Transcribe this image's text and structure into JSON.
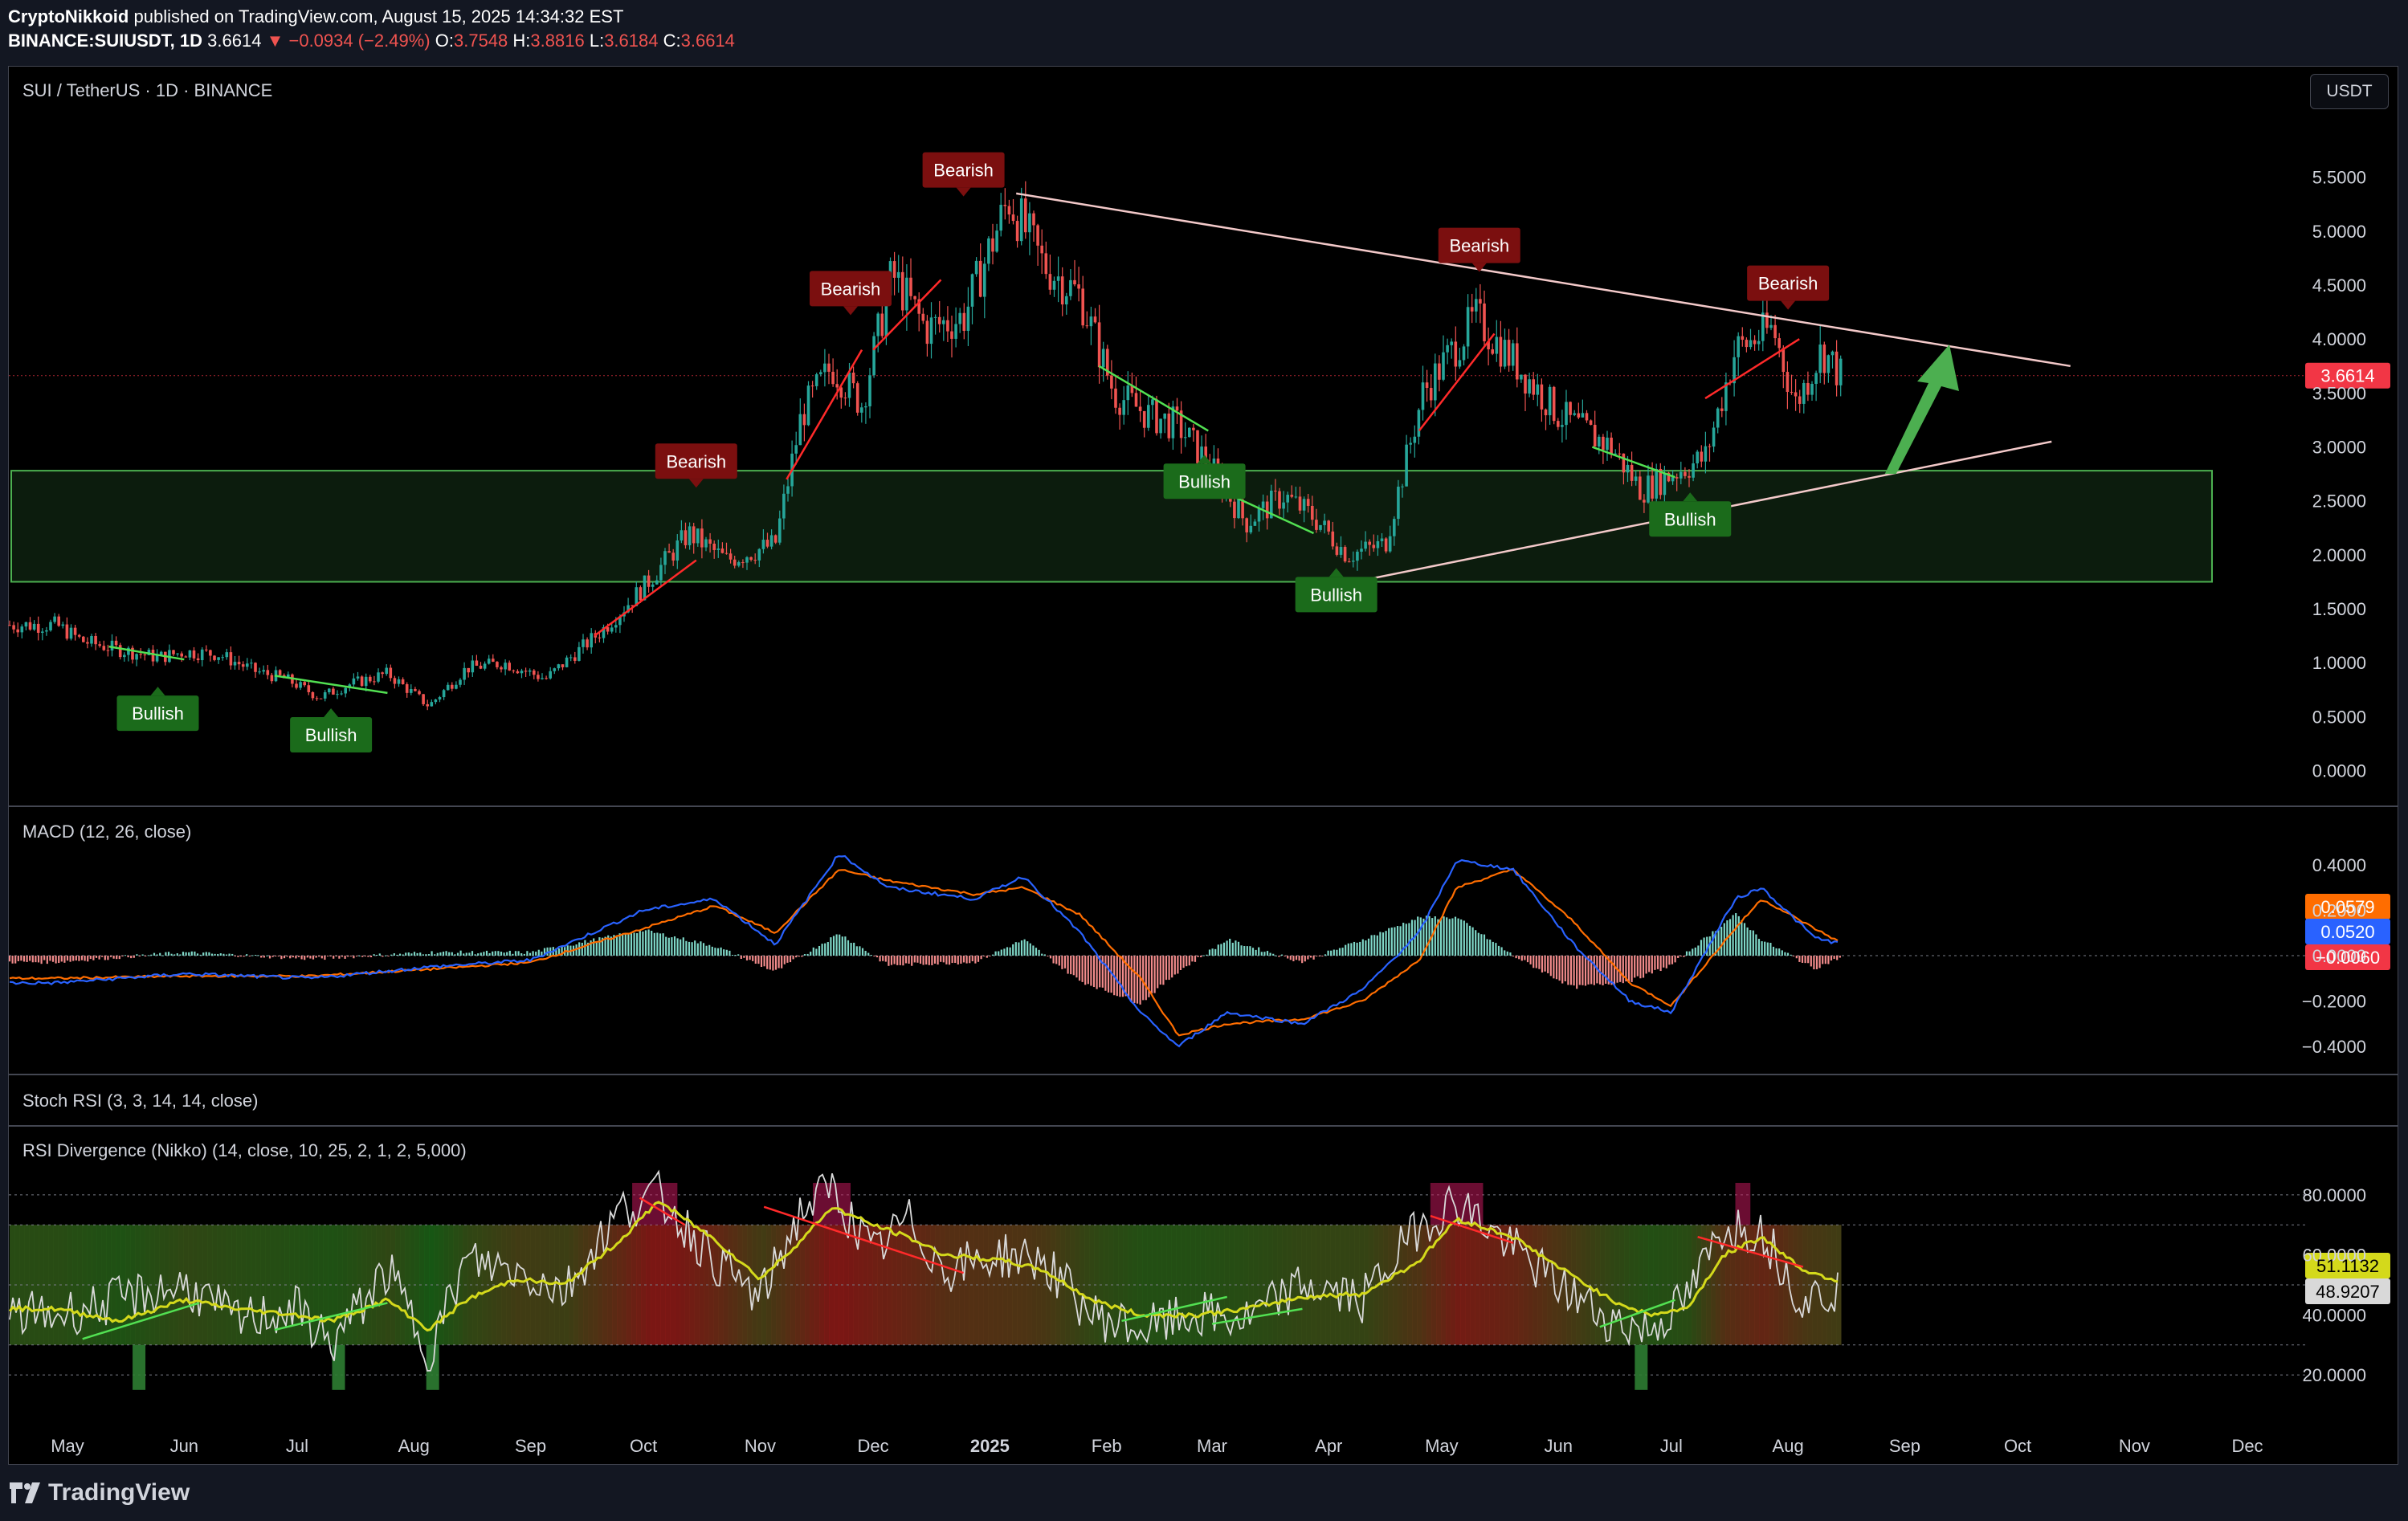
{
  "header": {
    "publisher": "CryptoNikkoid",
    "published_text": "published on TradingView.com, August 15, 2025 14:34:32 EST",
    "symbol": "BINANCE:SUIUSDT, 1D",
    "last": "3.6614",
    "change": "−0.0934 (−2.49%)",
    "ohlc_o_label": "O:",
    "ohlc_o": "3.7548",
    "ohlc_h_label": "H:",
    "ohlc_h": "3.8816",
    "ohlc_l_label": "L:",
    "ohlc_l": "3.6184",
    "ohlc_c_label": "C:",
    "ohlc_c": "3.6614"
  },
  "pane_labels": {
    "main": "SUI / TetherUS · 1D · BINANCE",
    "macd": "MACD (12, 26, close)",
    "stoch": "Stoch RSI (3, 3, 14, 14, close)",
    "rsi": "RSI Divergence (Nikko) (14, close, 10, 25, 2, 1, 2, 5,000)"
  },
  "currency_button": "USDT",
  "brand": "TradingView",
  "colors": {
    "background": "#000000",
    "up": "#26a69a",
    "down": "#ef5350",
    "zone": "#4caf50",
    "bearish_label": "#7b0f0f",
    "bullish_label": "#1b6b1b",
    "trendline": "#f3c9c9",
    "macd_line": "#2962ff",
    "signal_line": "#ff6d00",
    "rsi_line": "#d9d9d9",
    "rsi_ma": "#d4d91b",
    "arrow": "#4caf50",
    "price_tag": "#f23645"
  },
  "chart_data": [
    {
      "type": "candlestick",
      "title": "SUI / TetherUS · 1D · BINANCE",
      "x_ticks": [
        "May",
        "Jun",
        "Jul",
        "Aug",
        "Sep",
        "Oct",
        "Nov",
        "Dec",
        "2025",
        "Feb",
        "Mar",
        "Apr",
        "May",
        "Jun",
        "Jul",
        "Aug",
        "Sep",
        "Oct",
        "Nov",
        "Dec"
      ],
      "y_ticks": [
        "5.5000",
        "5.0000",
        "4.5000",
        "4.0000",
        "3.5000",
        "3.0000",
        "2.5000",
        "2.0000",
        "1.5000",
        "1.0000",
        "0.5000",
        "0.0000"
      ],
      "ylim": [
        -0.1,
        5.9
      ],
      "last_price_label": "3.6614",
      "price_path": [
        [
          "2024-04-28",
          1.35
        ],
        [
          "2024-05-05",
          1.2
        ],
        [
          "2024-05-15",
          1.12
        ],
        [
          "2024-05-25",
          1.05
        ],
        [
          "2024-06-01",
          1.1
        ],
        [
          "2024-06-10",
          1.08
        ],
        [
          "2024-06-20",
          0.92
        ],
        [
          "2024-06-28",
          0.85
        ],
        [
          "2024-07-07",
          0.68
        ],
        [
          "2024-07-15",
          0.8
        ],
        [
          "2024-07-25",
          0.9
        ],
        [
          "2024-08-05",
          0.6
        ],
        [
          "2024-08-15",
          0.95
        ],
        [
          "2024-08-25",
          1.0
        ],
        [
          "2024-09-05",
          0.85
        ],
        [
          "2024-09-20",
          1.3
        ],
        [
          "2024-10-01",
          1.7
        ],
        [
          "2024-10-13",
          2.2
        ],
        [
          "2024-10-23",
          1.95
        ],
        [
          "2024-11-05",
          2.1
        ],
        [
          "2024-11-12",
          3.3
        ],
        [
          "2024-11-20",
          3.75
        ],
        [
          "2024-11-28",
          3.4
        ],
        [
          "2024-12-06",
          4.6
        ],
        [
          "2024-12-15",
          4.1
        ],
        [
          "2024-12-25",
          4.2
        ],
        [
          "2025-01-06",
          5.3
        ],
        [
          "2025-01-15",
          4.7
        ],
        [
          "2025-01-25",
          4.4
        ],
        [
          "2025-02-03",
          3.5
        ],
        [
          "2025-02-12",
          3.3
        ],
        [
          "2025-02-20",
          3.2
        ],
        [
          "2025-03-01",
          2.8
        ],
        [
          "2025-03-10",
          2.3
        ],
        [
          "2025-03-20",
          2.55
        ],
        [
          "2025-03-28",
          2.35
        ],
        [
          "2025-04-06",
          2.0
        ],
        [
          "2025-04-16",
          2.1
        ],
        [
          "2025-04-26",
          3.5
        ],
        [
          "2025-05-10",
          4.2
        ],
        [
          "2025-05-20",
          3.8
        ],
        [
          "2025-06-01",
          3.3
        ],
        [
          "2025-06-15",
          3.0
        ],
        [
          "2025-06-23",
          2.6
        ],
        [
          "2025-07-01",
          2.75
        ],
        [
          "2025-07-10",
          2.9
        ],
        [
          "2025-07-18",
          3.9
        ],
        [
          "2025-07-28",
          4.1
        ],
        [
          "2025-08-03",
          3.4
        ],
        [
          "2025-08-10",
          3.9
        ],
        [
          "2025-08-15",
          3.6614
        ]
      ],
      "support_zone": [
        1.75,
        2.78
      ],
      "trendlines": [
        {
          "name": "upper",
          "from": [
            "2025-01-08",
            5.35
          ],
          "to": [
            "2025-10-15",
            3.75
          ]
        },
        {
          "name": "lower",
          "from": [
            "2025-04-08",
            1.75
          ],
          "to": [
            "2025-10-10",
            3.05
          ]
        }
      ],
      "annotations": [
        {
          "text": "Bullish",
          "x": "2024-05-25",
          "y": 0.8
        },
        {
          "text": "Bullish",
          "x": "2024-07-10",
          "y": 0.6
        },
        {
          "text": "Bearish",
          "x": "2024-10-15",
          "y": 2.6
        },
        {
          "text": "Bearish",
          "x": "2024-11-25",
          "y": 4.2
        },
        {
          "text": "Bearish",
          "x": "2024-12-25",
          "y": 5.3
        },
        {
          "text": "Bullish",
          "x": "2025-02-27",
          "y": 2.95
        },
        {
          "text": "Bullish",
          "x": "2025-04-03",
          "y": 1.9
        },
        {
          "text": "Bearish",
          "x": "2025-05-11",
          "y": 4.6
        },
        {
          "text": "Bullish",
          "x": "2025-07-06",
          "y": 2.6
        },
        {
          "text": "Bearish",
          "x": "2025-08-01",
          "y": 4.25
        }
      ]
    },
    {
      "type": "line",
      "title": "MACD (12, 26, close)",
      "y_ticks": [
        "0.4000",
        "0.2000",
        "0.0000",
        "−0.2000",
        "−0.4000"
      ],
      "ylim": [
        -0.46,
        0.46
      ],
      "series": [
        {
          "name": "MACD",
          "value_label": "0.0520",
          "points": [
            [
              "2024-04-28",
              -0.12
            ],
            [
              "2024-06-01",
              -0.08
            ],
            [
              "2024-07-05",
              -0.1
            ],
            [
              "2024-08-05",
              -0.05
            ],
            [
              "2024-09-01",
              -0.02
            ],
            [
              "2024-10-01",
              0.2
            ],
            [
              "2024-10-20",
              0.25
            ],
            [
              "2024-11-05",
              0.05
            ],
            [
              "2024-11-22",
              0.45
            ],
            [
              "2024-12-05",
              0.3
            ],
            [
              "2024-12-28",
              0.25
            ],
            [
              "2025-01-10",
              0.35
            ],
            [
              "2025-01-25",
              0.1
            ],
            [
              "2025-02-10",
              -0.25
            ],
            [
              "2025-02-20",
              -0.4
            ],
            [
              "2025-03-05",
              -0.25
            ],
            [
              "2025-03-25",
              -0.3
            ],
            [
              "2025-04-10",
              -0.15
            ],
            [
              "2025-04-25",
              0.1
            ],
            [
              "2025-05-05",
              0.42
            ],
            [
              "2025-05-20",
              0.38
            ],
            [
              "2025-06-05",
              0.05
            ],
            [
              "2025-06-20",
              -0.2
            ],
            [
              "2025-07-01",
              -0.25
            ],
            [
              "2025-07-18",
              0.25
            ],
            [
              "2025-07-25",
              0.3
            ],
            [
              "2025-08-08",
              0.08
            ],
            [
              "2025-08-15",
              0.052
            ]
          ]
        },
        {
          "name": "Signal",
          "value_label": "0.0579",
          "points": [
            [
              "2024-04-28",
              -0.1
            ],
            [
              "2024-06-01",
              -0.09
            ],
            [
              "2024-07-05",
              -0.09
            ],
            [
              "2024-08-05",
              -0.06
            ],
            [
              "2024-09-01",
              -0.03
            ],
            [
              "2024-10-01",
              0.12
            ],
            [
              "2024-10-20",
              0.22
            ],
            [
              "2024-11-05",
              0.1
            ],
            [
              "2024-11-22",
              0.38
            ],
            [
              "2024-12-05",
              0.33
            ],
            [
              "2024-12-28",
              0.27
            ],
            [
              "2025-01-10",
              0.3
            ],
            [
              "2025-01-25",
              0.18
            ],
            [
              "2025-02-10",
              -0.1
            ],
            [
              "2025-02-20",
              -0.35
            ],
            [
              "2025-03-05",
              -0.3
            ],
            [
              "2025-03-25",
              -0.28
            ],
            [
              "2025-04-10",
              -0.2
            ],
            [
              "2025-04-25",
              -0.02
            ],
            [
              "2025-05-05",
              0.3
            ],
            [
              "2025-05-20",
              0.38
            ],
            [
              "2025-06-05",
              0.15
            ],
            [
              "2025-06-20",
              -0.12
            ],
            [
              "2025-07-01",
              -0.22
            ],
            [
              "2025-07-18",
              0.12
            ],
            [
              "2025-07-25",
              0.25
            ],
            [
              "2025-08-08",
              0.12
            ],
            [
              "2025-08-15",
              0.0579
            ]
          ]
        }
      ],
      "histogram_label": "−0.0060"
    },
    {
      "type": "line",
      "title": "RSI Divergence (Nikko) (14, close, 10, 25, 2, 1, 2, 5,000)",
      "y_ticks": [
        "80.0000",
        "60.0000",
        "40.0000",
        "20.0000"
      ],
      "ylim": [
        12,
        88
      ],
      "bands": [
        30,
        70
      ],
      "series": [
        {
          "name": "RSI",
          "value_label": "48.9207",
          "points": [
            [
              "2024-04-28",
              40
            ],
            [
              "2024-05-15",
              45
            ],
            [
              "2024-06-01",
              50
            ],
            [
              "2024-06-15",
              38
            ],
            [
              "2024-07-01",
              42
            ],
            [
              "2024-07-10",
              30
            ],
            [
              "2024-07-25",
              55
            ],
            [
              "2024-08-05",
              28
            ],
            [
              "2024-08-15",
              58
            ],
            [
              "2024-08-28",
              55
            ],
            [
              "2024-09-10",
              48
            ],
            [
              "2024-09-25",
              75
            ],
            [
              "2024-10-05",
              80
            ],
            [
              "2024-10-20",
              58
            ],
            [
              "2024-11-01",
              45
            ],
            [
              "2024-11-12",
              75
            ],
            [
              "2024-11-20",
              82
            ],
            [
              "2024-12-01",
              60
            ],
            [
              "2024-12-10",
              72
            ],
            [
              "2024-12-20",
              55
            ],
            [
              "2025-01-05",
              60
            ],
            [
              "2025-01-15",
              58
            ],
            [
              "2025-01-28",
              40
            ],
            [
              "2025-02-10",
              35
            ],
            [
              "2025-02-25",
              40
            ],
            [
              "2025-03-10",
              38
            ],
            [
              "2025-03-25",
              50
            ],
            [
              "2025-04-10",
              45
            ],
            [
              "2025-04-25",
              70
            ],
            [
              "2025-05-05",
              78
            ],
            [
              "2025-05-20",
              62
            ],
            [
              "2025-06-01",
              50
            ],
            [
              "2025-06-15",
              38
            ],
            [
              "2025-06-25",
              35
            ],
            [
              "2025-07-05",
              45
            ],
            [
              "2025-07-15",
              70
            ],
            [
              "2025-07-25",
              68
            ],
            [
              "2025-08-05",
              45
            ],
            [
              "2025-08-15",
              48.9207
            ]
          ]
        },
        {
          "name": "RSI MA",
          "value_label": "51.1132",
          "points": [
            [
              "2024-04-28",
              42
            ],
            [
              "2024-05-15",
              38
            ],
            [
              "2024-06-01",
              45
            ],
            [
              "2024-06-15",
              42
            ],
            [
              "2024-07-01",
              40
            ],
            [
              "2024-07-10",
              38
            ],
            [
              "2024-07-25",
              45
            ],
            [
              "2024-08-05",
              35
            ],
            [
              "2024-08-15",
              45
            ],
            [
              "2024-08-28",
              52
            ],
            [
              "2024-09-10",
              50
            ],
            [
              "2024-09-25",
              65
            ],
            [
              "2024-10-05",
              78
            ],
            [
              "2024-10-20",
              65
            ],
            [
              "2024-11-01",
              52
            ],
            [
              "2024-11-12",
              65
            ],
            [
              "2024-11-20",
              76
            ],
            [
              "2024-12-01",
              70
            ],
            [
              "2024-12-10",
              66
            ],
            [
              "2024-12-20",
              60
            ],
            [
              "2025-01-05",
              58
            ],
            [
              "2025-01-15",
              55
            ],
            [
              "2025-01-28",
              45
            ],
            [
              "2025-02-10",
              40
            ],
            [
              "2025-02-25",
              40
            ],
            [
              "2025-03-10",
              42
            ],
            [
              "2025-03-25",
              46
            ],
            [
              "2025-04-10",
              47
            ],
            [
              "2025-04-25",
              58
            ],
            [
              "2025-05-05",
              72
            ],
            [
              "2025-05-20",
              66
            ],
            [
              "2025-06-01",
              56
            ],
            [
              "2025-06-15",
              45
            ],
            [
              "2025-06-25",
              40
            ],
            [
              "2025-07-05",
              42
            ],
            [
              "2025-07-15",
              60
            ],
            [
              "2025-07-25",
              66
            ],
            [
              "2025-08-05",
              55
            ],
            [
              "2025-08-15",
              51.1132
            ]
          ]
        }
      ]
    }
  ]
}
